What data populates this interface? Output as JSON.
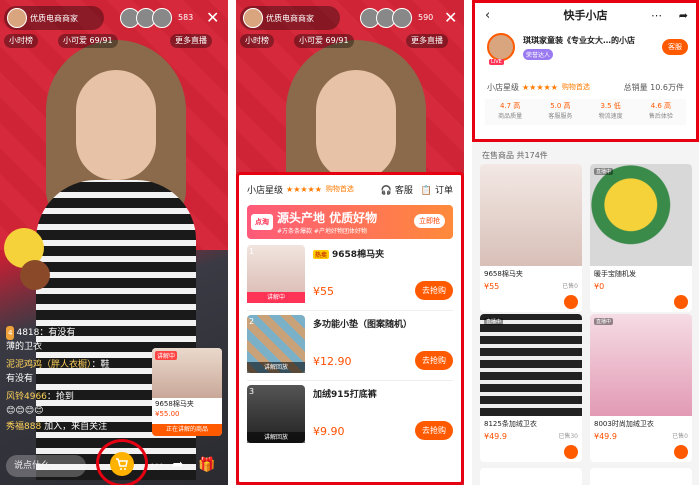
{
  "panel1": {
    "host_name": "优质电商商家",
    "viewer_count": "583",
    "tag_left": "小时榜",
    "tag_mid": "小可爱 69/91",
    "tag_right": "更多直播",
    "chat": [
      {
        "lvl": "4",
        "user": "",
        "text": "4818：有没有"
      },
      {
        "lvl": "",
        "user": "薄的卫衣",
        "text": ""
      },
      {
        "lvl": "",
        "user": "泥泥鸡鸡（胖人衣橱）",
        "text": "：鞋"
      },
      {
        "lvl": "",
        "user": "有没有",
        "text": ""
      },
      {
        "lvl": "",
        "user": "风铃4966",
        "text": "：抢到"
      },
      {
        "lvl": "",
        "user": "",
        "text": "😊😊😊😊"
      },
      {
        "lvl": "",
        "user": "秀福888",
        "text": "加入，来自关注"
      }
    ],
    "say_placeholder": "说点什么",
    "card": {
      "badge": "讲解中",
      "name": "9658棉马夹",
      "price": "¥55.00",
      "live": "正在讲解的商品"
    }
  },
  "panel2": {
    "host_name": "优质电商商家",
    "viewer_count": "590",
    "tag_left": "小时榜",
    "tag_mid": "小可爱 69/91",
    "tag_right": "更多直播",
    "header": {
      "star_label": "小店星级",
      "stars": "★★★★★",
      "tag": "购物首选",
      "service": "客服",
      "order": "订单"
    },
    "banner": {
      "logo": "点淘",
      "big": "源头产地 优质好物",
      "small": "#万条条爆款 #产地好物团体好物",
      "go": "立即抢"
    },
    "items": [
      {
        "idx": "1",
        "hot": "热卖",
        "title": "9658棉马夹",
        "price": "¥55",
        "buy": "去抢购",
        "flag": "讲解中",
        "color": "#e9c9c3"
      },
      {
        "idx": "2",
        "hot": "",
        "title": "多功能小垫（图案随机）",
        "price": "¥12.90",
        "buy": "去抢购",
        "flag": "讲解回放",
        "color": "#c9a27a"
      },
      {
        "idx": "3",
        "hot": "",
        "title": "加绒915打底裤",
        "price": "¥9.90",
        "buy": "去抢购",
        "flag": "讲解回放",
        "color": "#3a3a3a"
      }
    ]
  },
  "panel3": {
    "title": "快手小店",
    "shop_name": "琪琪家童装《专业女大…的小店",
    "vip": "荣誉达人",
    "live": "LIVE",
    "kefu": "客服",
    "rating_label": "小店星级",
    "stars": "★★★★★",
    "rating_tag": "购物首选",
    "total": "总销量 10.6万件",
    "metrics": [
      {
        "v": "4.7 高",
        "l": "商品质量"
      },
      {
        "v": "5.0 高",
        "l": "客服服务"
      },
      {
        "v": "3.5 低",
        "l": "物流速度"
      },
      {
        "v": "4.6 高",
        "l": "售后体验"
      }
    ],
    "onsale": "在售商品 共174件",
    "goods": [
      {
        "name": "9658棉马夹",
        "price": "¥55",
        "sold": "已售0",
        "hot": "",
        "color": "#e4d2cc"
      },
      {
        "name": "暖手宝随机发",
        "price": "¥0",
        "sold": "",
        "hot": "直播中",
        "color": "#f2d14a"
      },
      {
        "name": "8125条加绒卫衣",
        "price": "¥49.9",
        "sold": "已售30",
        "hot": "直播中",
        "color": "#b9c6cc"
      },
      {
        "name": "8003时尚加绒卫衣",
        "price": "¥49.9",
        "sold": "已售0",
        "hot": "直播中",
        "color": "#e7b7c7"
      }
    ],
    "colors": {
      "accent": "#ff5a00",
      "highlight": "#e50012"
    }
  }
}
